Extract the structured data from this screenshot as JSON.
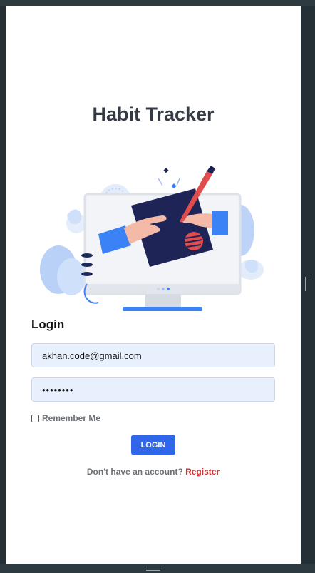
{
  "app": {
    "title": "Habit Tracker"
  },
  "login": {
    "heading": "Login",
    "email_value": "akhan.code@gmail.com",
    "password_masked": "••••••••",
    "remember_label": "Remember Me",
    "remember_checked": false,
    "submit_label": "LOGIN",
    "no_account_text": "Don't have an account?",
    "register_label": "Register"
  },
  "colors": {
    "primary_button": "#2f67e8",
    "register_link": "#d32f2f",
    "input_background": "#e8f0fe",
    "title_text": "#333a44"
  },
  "icons": {
    "hero": "login-illustration"
  }
}
